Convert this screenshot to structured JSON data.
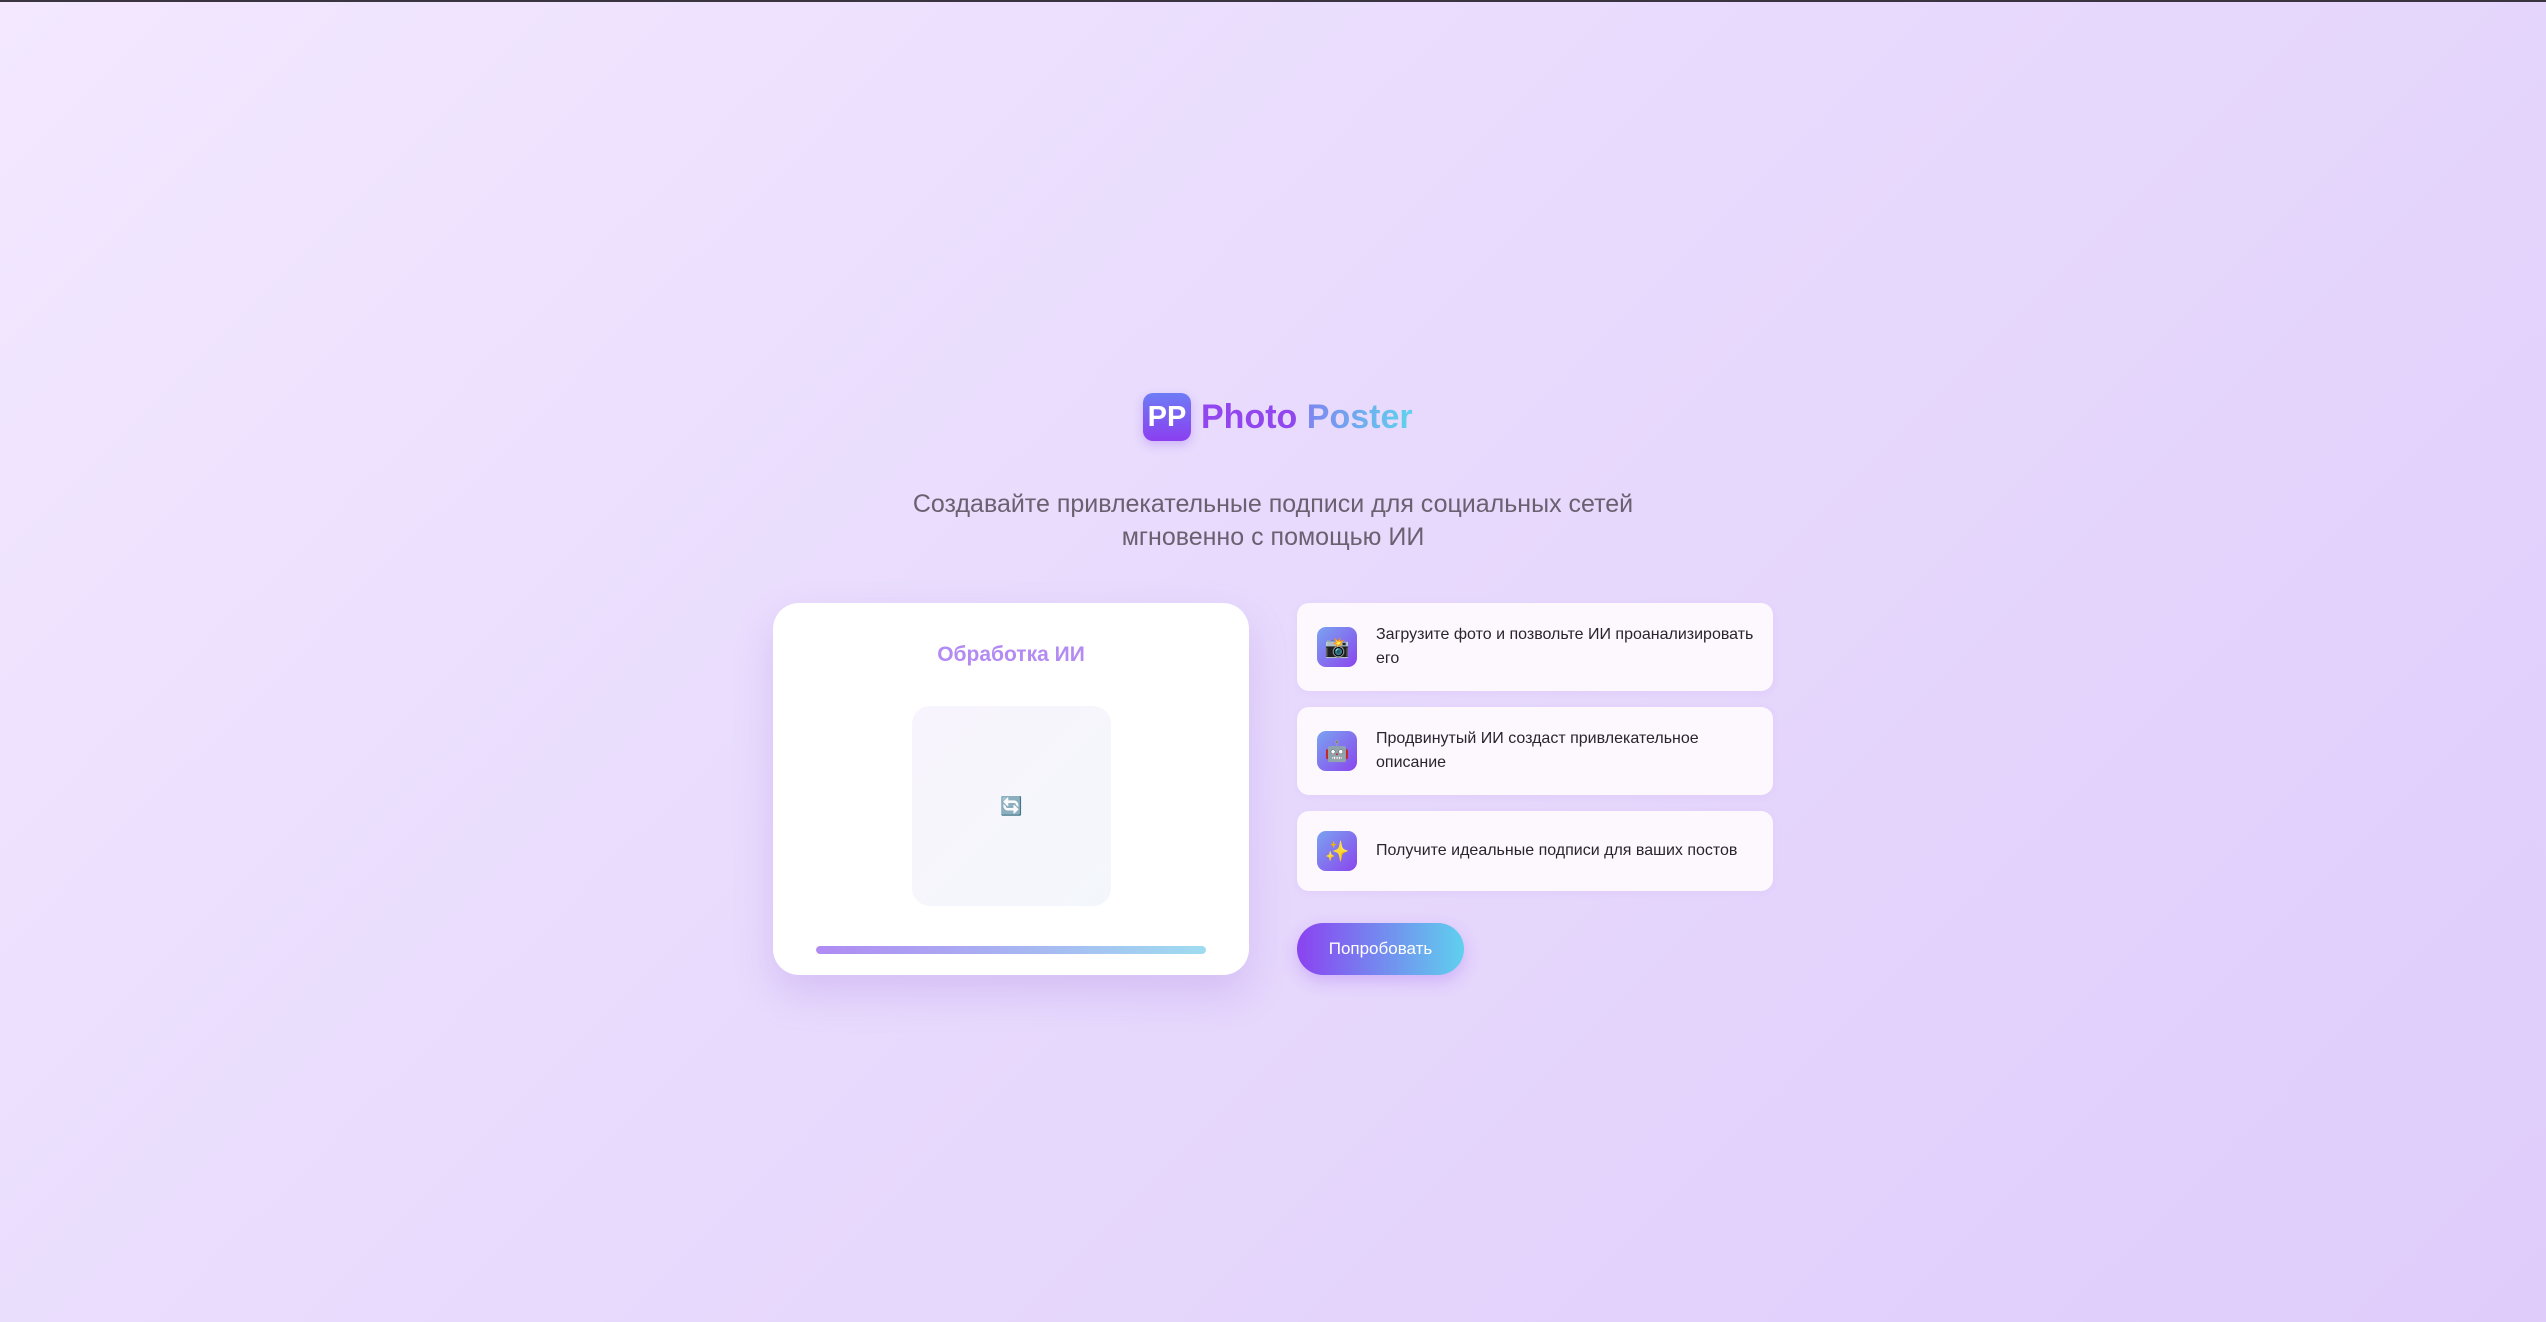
{
  "brand": {
    "badge": "PP",
    "name_part1": "Photo",
    "name_part2": "Poster"
  },
  "tagline": "Создавайте привлекательные подписи для социальных сетей мгновенно с помощью ИИ",
  "processing": {
    "title": "Обработка ИИ",
    "spinner_glyph": "🔄",
    "progress": 1.0
  },
  "features": [
    {
      "icon": "camera-icon",
      "glyph": "📸",
      "text": "Загрузите фото и позвольте ИИ проанализировать его"
    },
    {
      "icon": "robot-icon",
      "glyph": "🤖",
      "text": "Продвинутый ИИ создаст привлекательное описание"
    },
    {
      "icon": "sparkles-icon",
      "glyph": "✨",
      "text": "Получите идеальные подписи для ваших постов"
    }
  ],
  "cta": {
    "label": "Попробовать"
  },
  "colors": {
    "accent_purple": "#8a43f0",
    "accent_cyan": "#5fd0ee",
    "background": "#e9dcfd"
  }
}
